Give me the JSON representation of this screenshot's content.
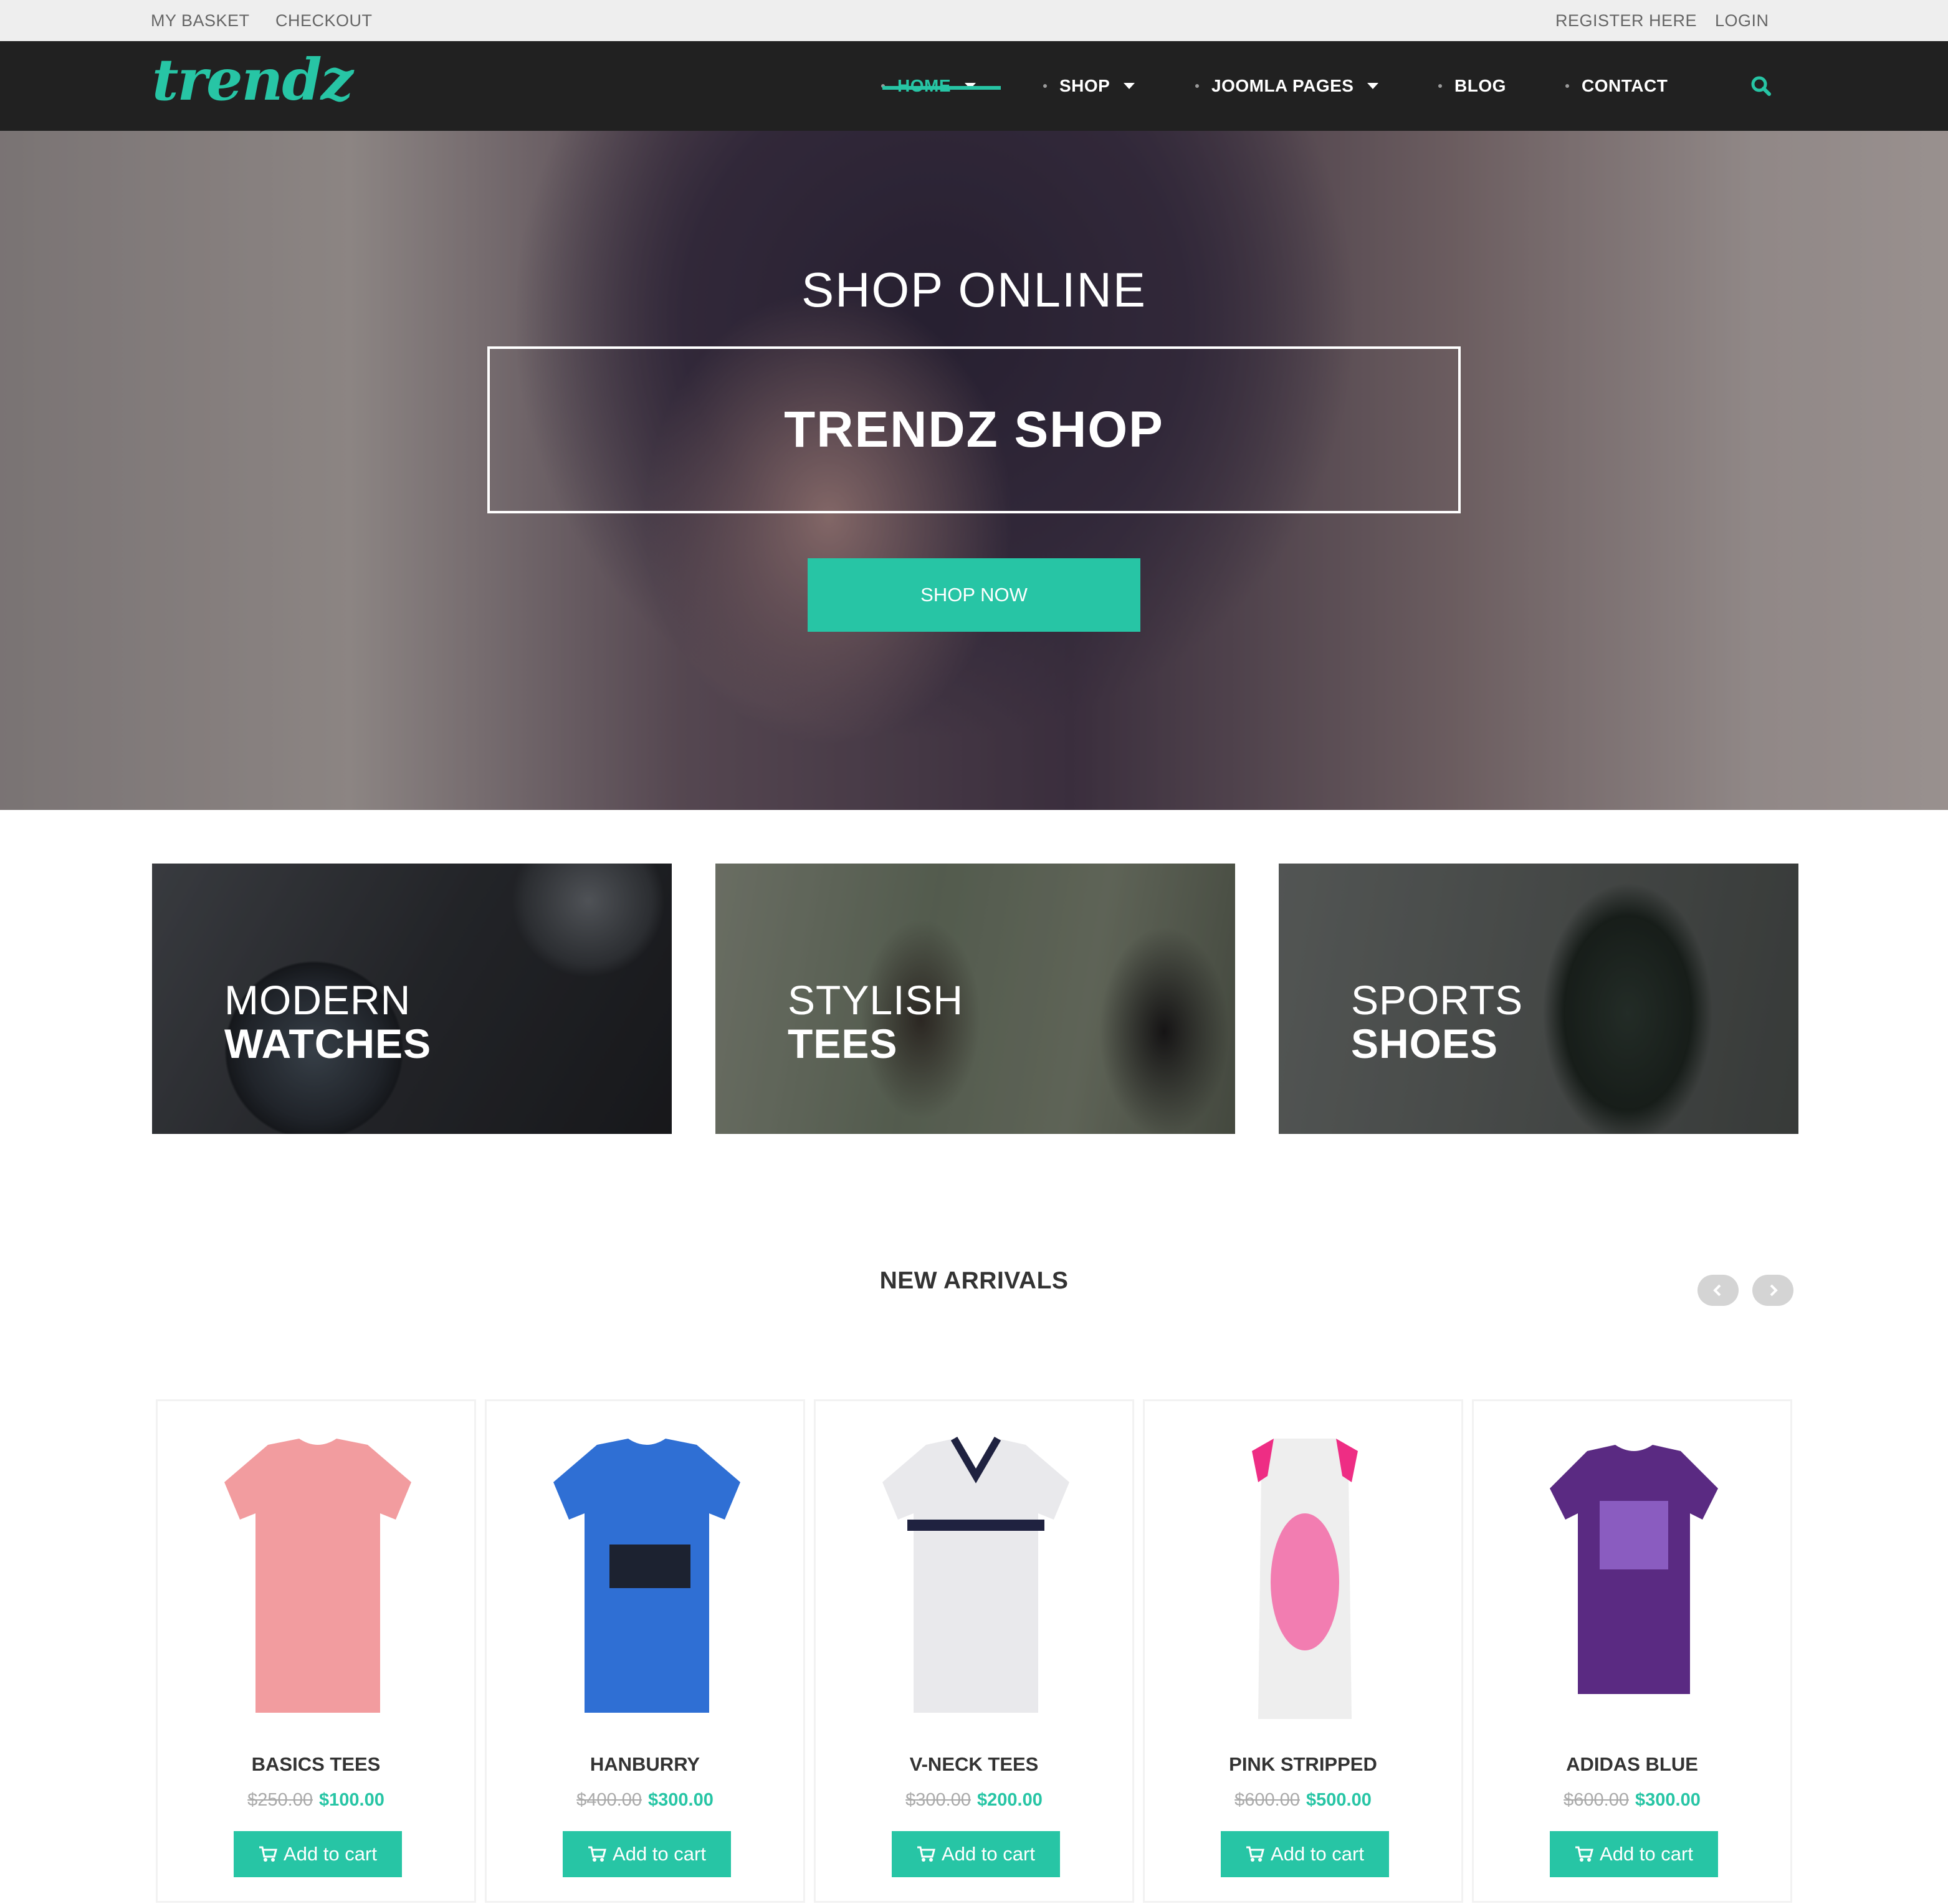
{
  "topbar": {
    "my_basket": "MY BASKET",
    "checkout": "CHECKOUT",
    "register": "REGISTER HERE",
    "login": "LOGIN"
  },
  "brand": {
    "logo": "trendz",
    "accent_color": "#27c5a5"
  },
  "nav": {
    "items": [
      {
        "label": "HOME",
        "dropdown": true,
        "active": true
      },
      {
        "label": "SHOP",
        "dropdown": true,
        "active": false
      },
      {
        "label": "JOOMLA PAGES",
        "dropdown": true,
        "active": false
      },
      {
        "label": "BLOG",
        "dropdown": false,
        "active": false
      },
      {
        "label": "CONTACT",
        "dropdown": false,
        "active": false
      }
    ],
    "search_icon": "search-icon"
  },
  "hero": {
    "subtitle": "SHOP ONLINE",
    "title": "TRENDZ SHOP",
    "button": "SHOP NOW"
  },
  "categories": [
    {
      "line1": "MODERN",
      "line2": "WATCHES"
    },
    {
      "line1": "STYLISH",
      "line2": "TEES"
    },
    {
      "line1": "SPORTS",
      "line2": "SHOES"
    }
  ],
  "new_arrivals": {
    "title": "NEW ARRIVALS",
    "prev_icon": "chevron-left-icon",
    "next_icon": "chevron-right-icon",
    "products": [
      {
        "name": "BASICS TEES",
        "old_price": "$250.00",
        "price": "$100.00",
        "button": "Add to cart",
        "color": "#f29c9f"
      },
      {
        "name": "HANBURRY",
        "old_price": "$400.00",
        "price": "$300.00",
        "button": "Add to cart",
        "color": "#2f6fd4"
      },
      {
        "name": "V-NECK TEES",
        "old_price": "$300.00",
        "price": "$200.00",
        "button": "Add to cart",
        "color": "#e9e9ec"
      },
      {
        "name": "PINK STRIPPED",
        "old_price": "$600.00",
        "price": "$500.00",
        "button": "Add to cart",
        "color": "#ee2d84"
      },
      {
        "name": "ADIDAS BLUE",
        "old_price": "$600.00",
        "price": "$300.00",
        "button": "Add to cart",
        "color": "#5a2a82"
      }
    ]
  }
}
